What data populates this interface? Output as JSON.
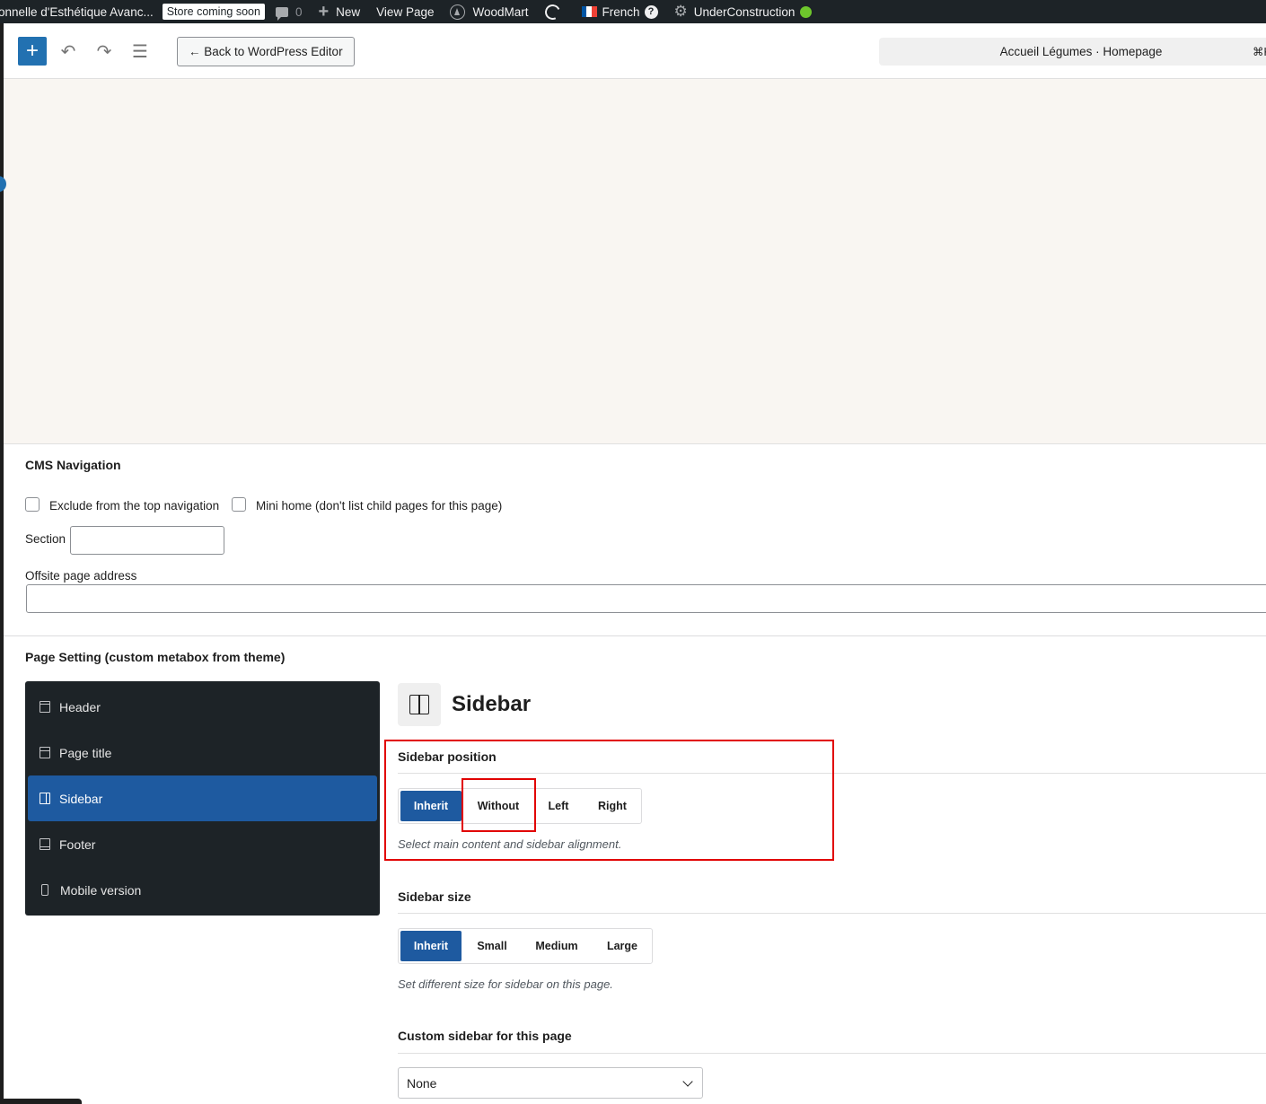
{
  "adminbar": {
    "site_name": "onnelle d'Esthétique Avanc...",
    "store_badge": "Store coming soon",
    "comments_count": "0",
    "new_label": "New",
    "view_page_label": "View Page",
    "woodmart_label": "WoodMart",
    "language_label": "French",
    "help_glyph": "?",
    "under_construction_label": "UnderConstruction"
  },
  "toolbar": {
    "add_glyph": "+",
    "undo_glyph": "↶",
    "redo_glyph": "↷",
    "outline_glyph": "☰",
    "back_label": "← Back to WordPress Editor",
    "document_title": "Accueil Légumes · Homepage",
    "shortcut": "⌘K"
  },
  "cms_navigation": {
    "title": "CMS Navigation",
    "exclude_label": "Exclude from the top navigation",
    "mini_home_label": "Mini home (don't list child pages for this page)",
    "section_label": "Section",
    "section_value": "",
    "offsite_label": "Offsite page address",
    "offsite_value": ""
  },
  "page_setting": {
    "title": "Page Setting (custom metabox from theme)",
    "nav": [
      {
        "label": "Header",
        "icon": "header-icon"
      },
      {
        "label": "Page title",
        "icon": "page-title-icon"
      },
      {
        "label": "Sidebar",
        "icon": "sidebar-icon"
      },
      {
        "label": "Footer",
        "icon": "footer-icon"
      },
      {
        "label": "Mobile version",
        "icon": "mobile-icon"
      }
    ],
    "active_nav": "Sidebar"
  },
  "sidebar_section": {
    "title": "Sidebar",
    "position": {
      "label": "Sidebar position",
      "options": [
        "Inherit",
        "Without",
        "Left",
        "Right"
      ],
      "selected": "Inherit",
      "hint": "Select main content and sidebar alignment."
    },
    "size": {
      "label": "Sidebar size",
      "options": [
        "Inherit",
        "Small",
        "Medium",
        "Large"
      ],
      "selected": "Inherit",
      "hint": "Set different size for sidebar on this page."
    },
    "custom": {
      "label": "Custom sidebar for this page",
      "selected": "None"
    }
  },
  "colors": {
    "accent": "#1e5aa0",
    "wp_blue": "#2271b1",
    "admin_bar": "#1d2327",
    "highlight": "#e10000"
  }
}
